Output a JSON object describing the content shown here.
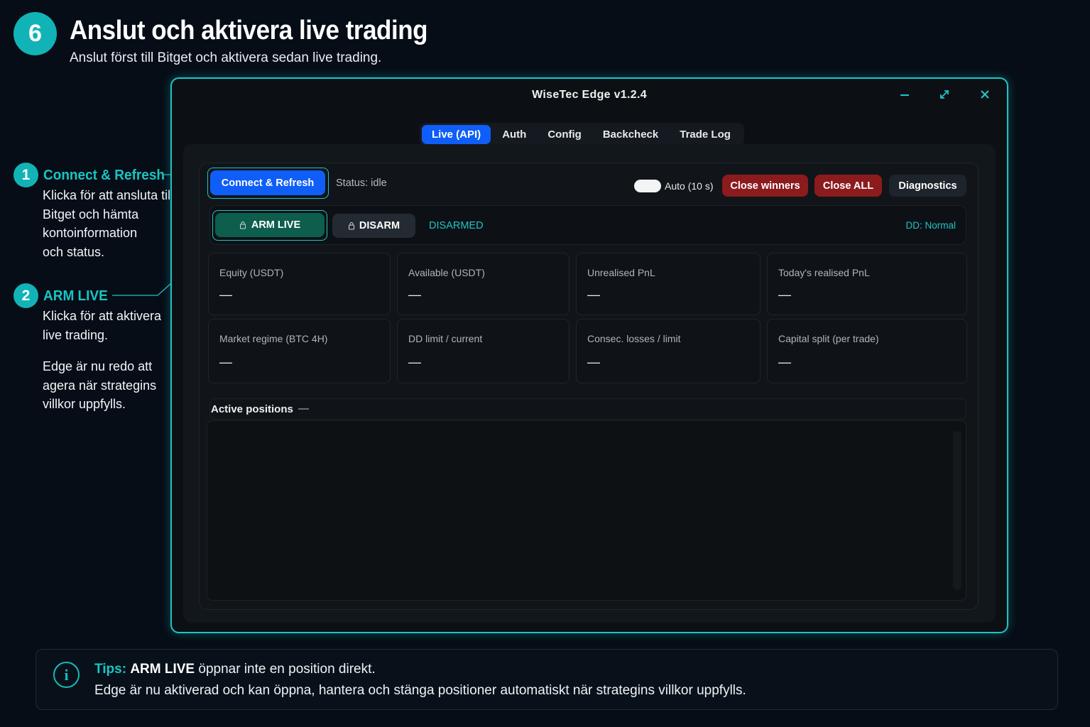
{
  "header": {
    "step_number": "6",
    "title": "Anslut och aktivera live trading",
    "subtitle": "Anslut först till Bitget och aktivera sedan live trading."
  },
  "annotations": [
    {
      "number": "1",
      "title": "Connect & Refresh",
      "lines": [
        "Klicka för att ansluta till",
        "Bitget och hämta",
        "kontoinformation",
        "och status."
      ]
    },
    {
      "number": "2",
      "title": "ARM LIVE",
      "lines": [
        "Klicka för att aktivera",
        "live trading."
      ],
      "extra_lines": [
        "Edge är nu redo att",
        "agera när strategins",
        "villkor uppfylls."
      ]
    }
  ],
  "app": {
    "title": "WiseTec Edge v1.2.4",
    "window_controls": {
      "minimize": "minimize-icon",
      "maximize": "expand-icon",
      "close": "close-icon"
    },
    "tabs": [
      {
        "label": "Live (API)",
        "active": true
      },
      {
        "label": "Auth",
        "active": false
      },
      {
        "label": "Config",
        "active": false
      },
      {
        "label": "Backcheck",
        "active": false
      },
      {
        "label": "Trade Log",
        "active": false
      }
    ],
    "toolbar": {
      "connect_label": "Connect & Refresh",
      "status": "Status: idle",
      "auto_label": "Auto (10 s)",
      "auto_enabled": false,
      "close_winners_label": "Close winners",
      "close_all_label": "Close ALL",
      "diagnostics_label": "Diagnostics"
    },
    "arm": {
      "arm_label": "ARM LIVE",
      "disarm_label": "DISARM",
      "state": "DISARMED",
      "dd_status": "DD: Normal",
      "icon": "lock-icon"
    },
    "cards": [
      {
        "label": "Equity (USDT)",
        "value": "—"
      },
      {
        "label": "Available (USDT)",
        "value": "—"
      },
      {
        "label": "Unrealised PnL",
        "value": "—"
      },
      {
        "label": "Today's realised PnL",
        "value": "—"
      },
      {
        "label": "Market regime (BTC 4H)",
        "value": "—"
      },
      {
        "label": "DD limit / current",
        "value": "—"
      },
      {
        "label": "Consec. losses / limit",
        "value": "—"
      },
      {
        "label": "Capital split (per trade)",
        "value": "—"
      }
    ],
    "positions": {
      "title": "Active positions",
      "count": "—"
    }
  },
  "tips": {
    "label": "Tips:",
    "strong": "ARM LIVE",
    "line1_rest": " öppnar inte en position direkt.",
    "line2": "Edge är nu aktiverad och kan öppna, hantera och stänga positioner automatiskt när strategins villkor uppfylls."
  },
  "colors": {
    "accent": "#1fc4c6",
    "primary_button": "#0f5ef7",
    "danger_button": "#8c1b1e",
    "arm_button": "#0d5e4d",
    "background": "#060d16"
  }
}
